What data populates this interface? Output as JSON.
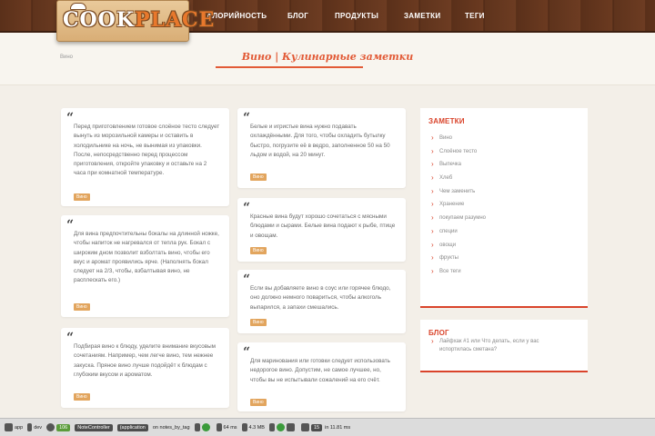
{
  "header": {
    "logo_prefix": "COOK",
    "logo_suffix": "PLACE",
    "nav": [
      "КАЛОРИЙНОСТЬ",
      "БЛОГ",
      "ПРОДУКТЫ",
      "ЗАМЕТКИ",
      "ТЕГИ"
    ]
  },
  "breadcrumb": "Вино",
  "page_title": "Вино | Кулинарные заметки",
  "notes": [
    {
      "text": "Перед приготовлением готовое слоёное тесто следует вынуть из морозильной камеры и оставить в холодильнике на ночь, не вынимая из упаковки. После, непосредственно перед процессом приготовления, откройте упаковку и оставьте на 2 часа при комнатной температуре.",
      "tag": "Вино"
    },
    {
      "text": "Для вина предпочтительны бокалы на длинной ножке, чтобы напиток не нагревался от тепла рук. Бокал с широким дном позволит взболтать вино, чтобы его вкус и аромат проявились ярче. (Наполнять бокал следует на 2/3, чтобы, взбалтывая вино, не расплескать его.)",
      "tag": "Вино"
    },
    {
      "text": "Подбирая вино к блюду, уделите внимание вкусовым сочетаниям. Например, чем легче вино, тем нежнее закуска. Пряное вино лучше подойдёт к блюдам с глубоким вкусом и ароматом.",
      "tag": "Вино"
    },
    {
      "text": "Белые и игристые вина нужно подавать охлаждёнными. Для того, чтобы охладить бутылку быстро, погрузите её в ведро, заполненное 50 на 50 льдом и водой, на 20 минут.",
      "tag": "Вино"
    },
    {
      "text": "Красные вина будут хорошо сочетаться с мясными блюдами и сырами. Белые вина подают к рыбе, птице и овощам.",
      "tag": "Вино"
    },
    {
      "text": "Если вы добавляете вино в соус или горячее блюдо, оно должно немного повариться, чтобы алкоголь выпарился, а запахи смешались.",
      "tag": "Вино"
    },
    {
      "text": "Для маринования или готовки следует использовать недорогое вино. Допустим, не самое лучшее, но, чтобы вы не испытывали сожалений на его счёт.",
      "tag": "Вино"
    }
  ],
  "sidebar": {
    "notes_title": "ЗАМЕТКИ",
    "notes_items": [
      "Вино",
      "Слоёное тесто",
      "Выпечка",
      "Хлеб",
      "Чем заменить",
      "Хранение",
      "покупаем разумно",
      "специи",
      "овощи",
      "фрукты",
      "Все теги"
    ],
    "blog_title": "БЛОГ",
    "blog_item": "Лайфхак #1 или Что делать, если у вас испортилась сметана?"
  },
  "taskbar": {
    "items": [
      "app",
      "dev",
      "106",
      "NoteController",
      "(application",
      "on notes_by_tag",
      "64 ms",
      "4.3 MB",
      "15",
      "in 11.81 ms"
    ]
  }
}
